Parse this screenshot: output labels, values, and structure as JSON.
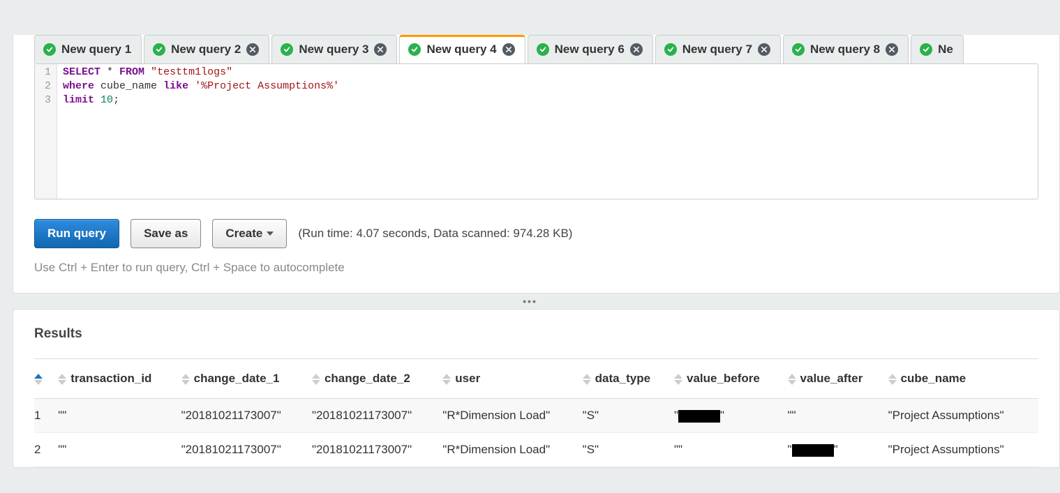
{
  "tabs": [
    {
      "label": "New query 1",
      "status": "ok",
      "closable": false,
      "active": false
    },
    {
      "label": "New query 2",
      "status": "ok",
      "closable": true,
      "active": false
    },
    {
      "label": "New query 3",
      "status": "ok",
      "closable": true,
      "active": false
    },
    {
      "label": "New query 4",
      "status": "ok",
      "closable": true,
      "active": true
    },
    {
      "label": "New query 6",
      "status": "ok",
      "closable": true,
      "active": false
    },
    {
      "label": "New query 7",
      "status": "ok",
      "closable": true,
      "active": false
    },
    {
      "label": "New query 8",
      "status": "ok",
      "closable": true,
      "active": false
    },
    {
      "label": "Ne",
      "status": "ok",
      "closable": false,
      "active": false
    }
  ],
  "editor": {
    "lines": [
      "1",
      "2",
      "3"
    ],
    "tokens": [
      [
        {
          "t": "kw",
          "v": "SELECT"
        },
        {
          "t": "op",
          "v": " * "
        },
        {
          "t": "kw",
          "v": "FROM"
        },
        {
          "t": "op",
          "v": " "
        },
        {
          "t": "str",
          "v": "\"testtm1logs\""
        }
      ],
      [
        {
          "t": "kw",
          "v": "where"
        },
        {
          "t": "op",
          "v": " cube_name "
        },
        {
          "t": "kw",
          "v": "like"
        },
        {
          "t": "op",
          "v": " "
        },
        {
          "t": "str",
          "v": "'%Project Assumptions%'"
        }
      ],
      [
        {
          "t": "kw",
          "v": "limit"
        },
        {
          "t": "op",
          "v": " "
        },
        {
          "t": "num",
          "v": "10"
        },
        {
          "t": "op",
          "v": ";"
        }
      ]
    ]
  },
  "buttons": {
    "run": "Run query",
    "save_as": "Save as",
    "create": "Create"
  },
  "run_info": "(Run time: 4.07 seconds, Data scanned: 974.28 KB)",
  "hint": "Use Ctrl + Enter to run query, Ctrl + Space to autocomplete",
  "splitter": "•••",
  "results": {
    "title": "Results",
    "columns": [
      "",
      "transaction_id",
      "change_date_1",
      "change_date_2",
      "user",
      "data_type",
      "value_before",
      "value_after",
      "cube_name"
    ],
    "rows": [
      {
        "n": "1",
        "transaction_id": "\"\"",
        "change_date_1": "\"20181021173007\"",
        "change_date_2": "\"20181021173007\"",
        "user": "\"R*Dimension Load\"",
        "data_type": "\"S\"",
        "value_before": "__REDACT__",
        "value_after": "\"\"",
        "cube_name": "\"Project Assumptions\""
      },
      {
        "n": "2",
        "transaction_id": "\"\"",
        "change_date_1": "\"20181021173007\"",
        "change_date_2": "\"20181021173007\"",
        "user": "\"R*Dimension Load\"",
        "data_type": "\"S\"",
        "value_before": "\"\"",
        "value_after": "__REDACT__",
        "cube_name": "\"Project Assumptions\""
      }
    ]
  }
}
